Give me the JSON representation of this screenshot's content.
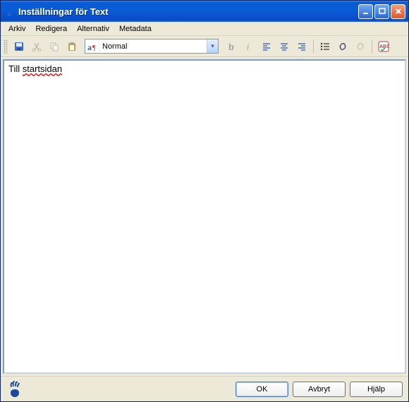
{
  "window": {
    "title": "Inställningar för Text"
  },
  "menu": {
    "arkiv": "Arkiv",
    "redigera": "Redigera",
    "alternativ": "Alternativ",
    "metadata": "Metadata"
  },
  "toolbar": {
    "style_selected": "Normal"
  },
  "editor": {
    "text_part1": "Till ",
    "text_part2": "startsidan"
  },
  "buttons": {
    "ok": "OK",
    "cancel": "Avbryt",
    "help": "Hjälp"
  }
}
